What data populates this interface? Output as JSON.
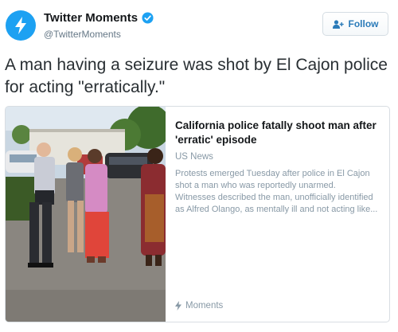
{
  "account": {
    "name": "Twitter Moments",
    "handle": "@TwitterMoments",
    "verified": true
  },
  "follow_button": {
    "label": "Follow",
    "icon": "follow-person-plus-icon"
  },
  "tweet": {
    "text": "A man having a seizure was shot by El Cajon police for acting \"erratically.\""
  },
  "card": {
    "title": "California police fatally shoot man after 'erratic' episode",
    "source": "US News",
    "description": "Protests emerged Tuesday after police in El Cajon shot a man who was reportedly unarmed. Witnesses described the man, unofficially identified as Alfred Olango, as mentally ill and not acting like...",
    "footer_label": "Moments",
    "footer_icon": "lightning-bolt-icon"
  },
  "colors": {
    "brand_blue": "#1da1f2",
    "link_blue": "#2b7bb9",
    "text_dark": "#14171a",
    "text_muted": "#8899a6"
  }
}
